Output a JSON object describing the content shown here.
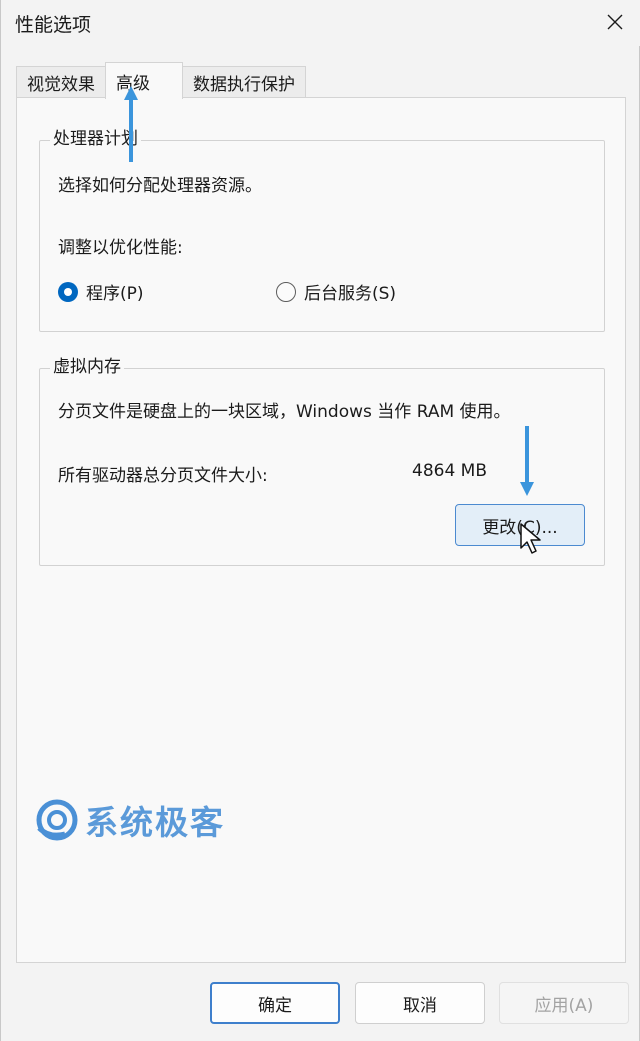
{
  "window": {
    "title": "性能选项"
  },
  "tabs": [
    {
      "label": "视觉效果",
      "active": false
    },
    {
      "label": "高级",
      "active": true
    },
    {
      "label": "数据执行保护",
      "active": false
    }
  ],
  "processor": {
    "legend": "处理器计划",
    "description": "选择如何分配处理器资源。",
    "adjust_label": "调整以优化性能:",
    "options": [
      {
        "label": "程序(P)",
        "checked": true
      },
      {
        "label": "后台服务(S)",
        "checked": false
      }
    ]
  },
  "virtual_memory": {
    "legend": "虚拟内存",
    "description": "分页文件是硬盘上的一块区域，Windows 当作 RAM 使用。",
    "total_label": "所有驱动器总分页文件大小:",
    "total_value": "4864 MB",
    "change_button": "更改(C)..."
  },
  "footer": {
    "ok": "确定",
    "cancel": "取消",
    "apply": "应用(A)"
  },
  "watermark": {
    "text": "系统极客"
  },
  "colors": {
    "accent": "#0067c0",
    "annotation_arrow": "#3b95dc",
    "watermark": "#4a90d6"
  },
  "icons": [
    "close-icon",
    "radio-checked-icon",
    "radio-unchecked-icon",
    "arrow-up-icon",
    "arrow-down-icon",
    "mouse-cursor-icon",
    "logo-icon"
  ]
}
